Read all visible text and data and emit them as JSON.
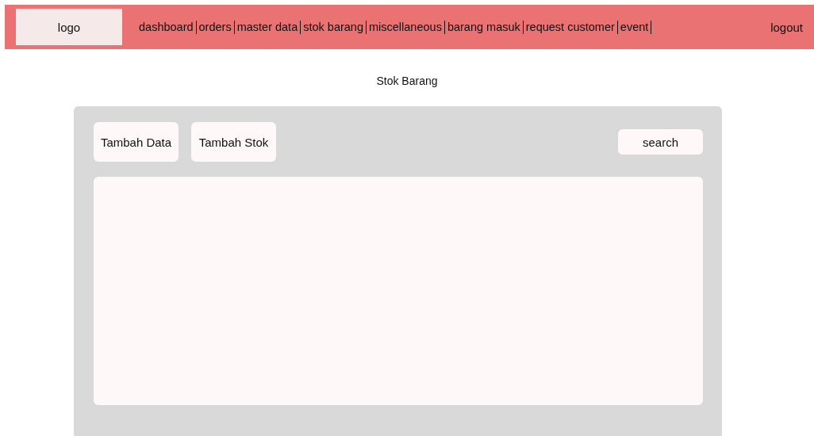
{
  "header": {
    "logo": "logo",
    "nav_links": [
      "dashboard",
      "orders",
      "master data",
      "stok barang",
      "miscellaneous",
      "barang masuk",
      "request customer",
      "event"
    ],
    "logout": "logout"
  },
  "page_title": "Stok Barang",
  "toolbar": {
    "buttons": [
      "Tambah Data",
      "Tambah Stok"
    ],
    "search": {
      "placeholder": "search"
    }
  }
}
